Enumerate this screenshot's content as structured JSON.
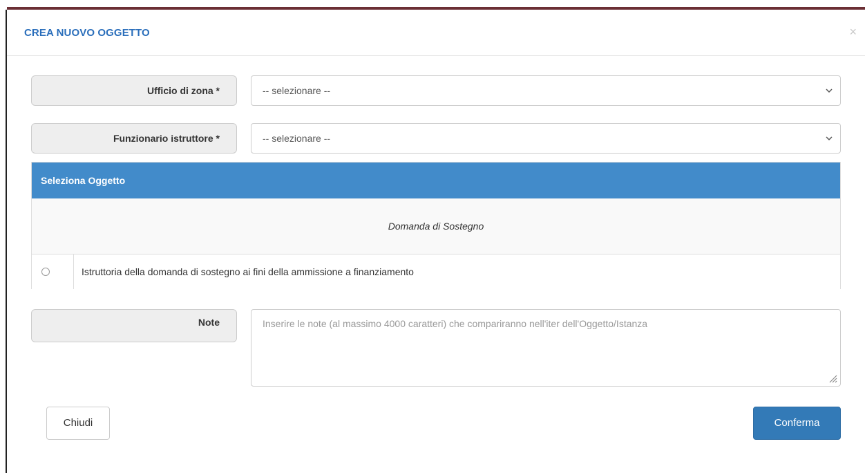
{
  "modal": {
    "title": "CREA NUOVO OGGETTO",
    "close_icon": "×"
  },
  "form": {
    "ufficio": {
      "label": "Ufficio di zona *",
      "value": "-- selezionare --"
    },
    "funzionario": {
      "label": "Funzionario istruttore *",
      "value": "-- selezionare --"
    }
  },
  "panel": {
    "header": "Seleziona Oggetto",
    "group": "Domanda di Sostegno",
    "rows": [
      {
        "label": "Istruttoria della domanda di sostegno ai fini della ammissione a finanziamento",
        "selected": false
      }
    ]
  },
  "note": {
    "label": "Note",
    "placeholder": "Inserire le note (al massimo 4000 caratteri) che compariranno nell'iter dell'Oggetto/Istanza",
    "value": ""
  },
  "footer": {
    "close_label": "Chiudi",
    "confirm_label": "Conferma"
  },
  "colors": {
    "title": "#2a6ebb",
    "panel_header": "#428bca",
    "confirm_button": "#337ab7"
  }
}
